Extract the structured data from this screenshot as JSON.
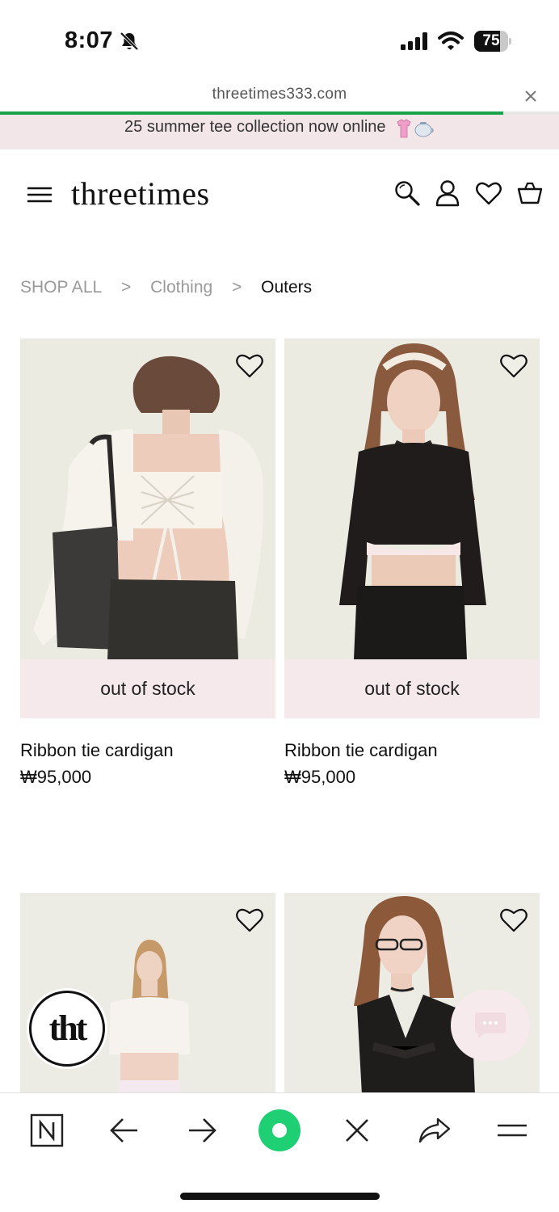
{
  "status_bar": {
    "time": "8:07",
    "battery_level": 75,
    "battery_label": "75",
    "icons": [
      "bell-slash-icon",
      "signal-icon",
      "wifi-icon",
      "battery-icon"
    ]
  },
  "browser": {
    "url": "threetimes333.com",
    "load_progress": 0.9,
    "accent_color": "#1aa34a"
  },
  "announcement": {
    "text": "25 summer tee collection now online",
    "emoji_icons": [
      "pink-tshirt-icon",
      "teapot-icon"
    ]
  },
  "header": {
    "logo": "threetimes",
    "icons": [
      "menu-icon",
      "search-icon",
      "account-icon",
      "wishlist-icon",
      "cart-icon"
    ]
  },
  "breadcrumb": {
    "items": [
      "SHOP ALL",
      "Clothing",
      "Outers"
    ],
    "separator": ">"
  },
  "products": [
    {
      "name": "Ribbon tie cardigan",
      "price": "₩95,000",
      "status": "out of stock",
      "image": "model-back-white-cardigan"
    },
    {
      "name": "Ribbon tie cardigan",
      "price": "₩95,000",
      "status": "out of stock",
      "image": "model-front-black-cardigan"
    },
    {
      "image": "model-white-tie-top"
    },
    {
      "image": "model-black-tie-top"
    }
  ],
  "floating": {
    "brand_badge": "tht",
    "chat_icon": "chat-bubble-icon"
  },
  "toolbar": {
    "icons": [
      "naver-n-icon",
      "back-arrow-icon",
      "forward-arrow-icon",
      "green-circle-home-icon",
      "close-icon",
      "share-icon",
      "menu-lines-icon"
    ]
  },
  "colors": {
    "banner_bg": "#f3e6e8",
    "stock_band_bg": "#f5e9eb",
    "image_bg": "#ecebe4",
    "toolbar_green": "#1fcf73"
  }
}
